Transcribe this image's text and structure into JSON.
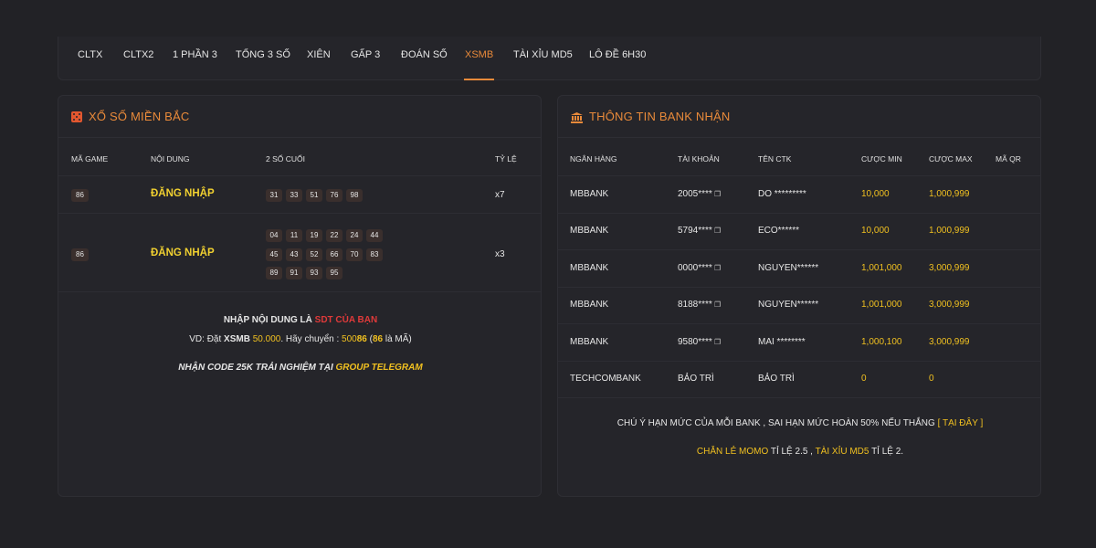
{
  "tabs": [
    {
      "label": "CLTX"
    },
    {
      "label": "CLTX2"
    },
    {
      "label": "1 PHẦN 3"
    },
    {
      "label": "TỔNG 3 SỐ"
    },
    {
      "label": "XIÊN"
    },
    {
      "label": "GẤP 3"
    },
    {
      "label": "ĐOÁN SỐ"
    },
    {
      "label": "XSMB"
    },
    {
      "label": "TÀI XỈU MD5"
    },
    {
      "label": "LÔ ĐỀ 6H30"
    }
  ],
  "active_tab": "XSMB",
  "left": {
    "title": "XỔ SỐ MIỀN BẮC",
    "headers": {
      "game": "MÃ GAME",
      "content": "NỘI DUNG",
      "last2": "2 SỐ CUỐI",
      "rate": "TỶ LỆ"
    },
    "rows": [
      {
        "game": "86",
        "content": "ĐĂNG NHẬP",
        "numbers": [
          "31",
          "33",
          "51",
          "76",
          "98"
        ],
        "rate": "x7"
      },
      {
        "game": "86",
        "content": "ĐĂNG NHẬP",
        "numbers": [
          "04",
          "11",
          "19",
          "22",
          "24",
          "44",
          "45",
          "43",
          "52",
          "66",
          "70",
          "83",
          "89",
          "91",
          "93",
          "95"
        ],
        "rate": "x3"
      }
    ],
    "note1_a": "NHẬP NỘI DUNG LÀ ",
    "note1_b": "SDT CỦA BẠN",
    "note2_a": "VD: Đặt ",
    "note2_b": "XSMB",
    "note2_c": " 50.000",
    "note2_d": ". Hãy chuyển : ",
    "note2_e": "500",
    "note2_f": "86",
    "note2_g": " (",
    "note2_h": "86",
    "note2_i": " là MÃ)",
    "note3_a": "NHẬN CODE 25K TRẢI NGHIỆM TẠI ",
    "note3_b": "GROUP TELEGRAM"
  },
  "right": {
    "title": "THÔNG TIN BANK NHẬN",
    "headers": {
      "bank": "NGÂN HÀNG",
      "account": "TÀI KHOẢN",
      "name": "TÊN CTK",
      "min": "CƯỢC MIN",
      "max": "CƯỢC MAX",
      "qr": "MÃ QR"
    },
    "rows": [
      {
        "bank": "MBBANK",
        "account": "2005****",
        "name": "DO *********",
        "min": "10,000",
        "max": "1,000,999"
      },
      {
        "bank": "MBBANK",
        "account": "5794****",
        "name": "ECO******",
        "min": "10,000",
        "max": "1,000,999"
      },
      {
        "bank": "MBBANK",
        "account": "0000****",
        "name": "NGUYEN******",
        "min": "1,001,000",
        "max": "3,000,999"
      },
      {
        "bank": "MBBANK",
        "account": "8188****",
        "name": "NGUYEN******",
        "min": "1,001,000",
        "max": "3,000,999"
      },
      {
        "bank": "MBBANK",
        "account": "9580****",
        "name": "MAI ********",
        "min": "1,000,100",
        "max": "3,000,999"
      },
      {
        "bank": "TECHCOMBANK",
        "account": "BẢO TRÌ",
        "name": "BẢO TRÌ",
        "min": "0",
        "max": "0"
      }
    ],
    "note1_a": "CHÚ Ý HẠN MỨC CỦA MỖI BANK , SAI HẠN MỨC HOÀN 50% NẾU THẮNG ",
    "note1_b": "[ TẠI ĐÂY ]",
    "note2_a": "CHẴN LẺ MOMO",
    "note2_b": " TỈ LỆ 2.5 , ",
    "note2_c": "TÀI XỈU MD5",
    "note2_d": " TỈ LỆ 2."
  },
  "colors": {
    "accent": "#e98a3a",
    "yellow": "#f0c020",
    "red": "#e03a3a",
    "bg": "#222226",
    "card": "#25252a"
  }
}
